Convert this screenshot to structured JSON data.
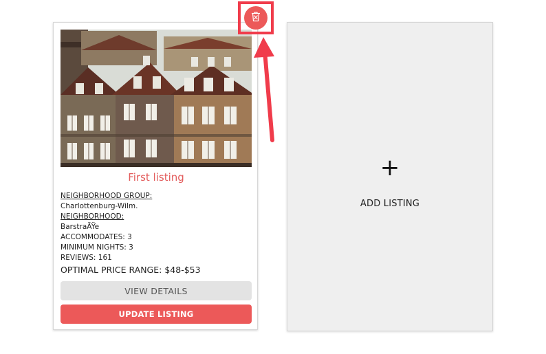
{
  "listing": {
    "title": "First listing",
    "neighborhood_group_label": "NEIGHBORHOOD GROUP:",
    "neighborhood_group_value": "Charlottenburg-Wilm.",
    "neighborhood_label": "NEIGHBORHOOD:",
    "neighborhood_value": "BarstraÃŸe",
    "accommodates": "ACCOMMODATES: 3",
    "minimum_nights": "MINIMUM NIGHTS: 3",
    "reviews": "REVIEWS: 161",
    "optimal_price": "OPTIMAL PRICE RANGE: $48-$53",
    "view_details_label": "VIEW DETAILS",
    "update_label": "UPDATE LISTING",
    "delete_icon": "trash-icon"
  },
  "add_listing": {
    "plus": "+",
    "label": "ADD LISTING"
  },
  "colors": {
    "accent": "#ec5959",
    "title": "#e35d5d",
    "highlight": "#f03c4b",
    "add_card_bg": "#efefef",
    "view_button_bg": "#e3e3e3"
  }
}
